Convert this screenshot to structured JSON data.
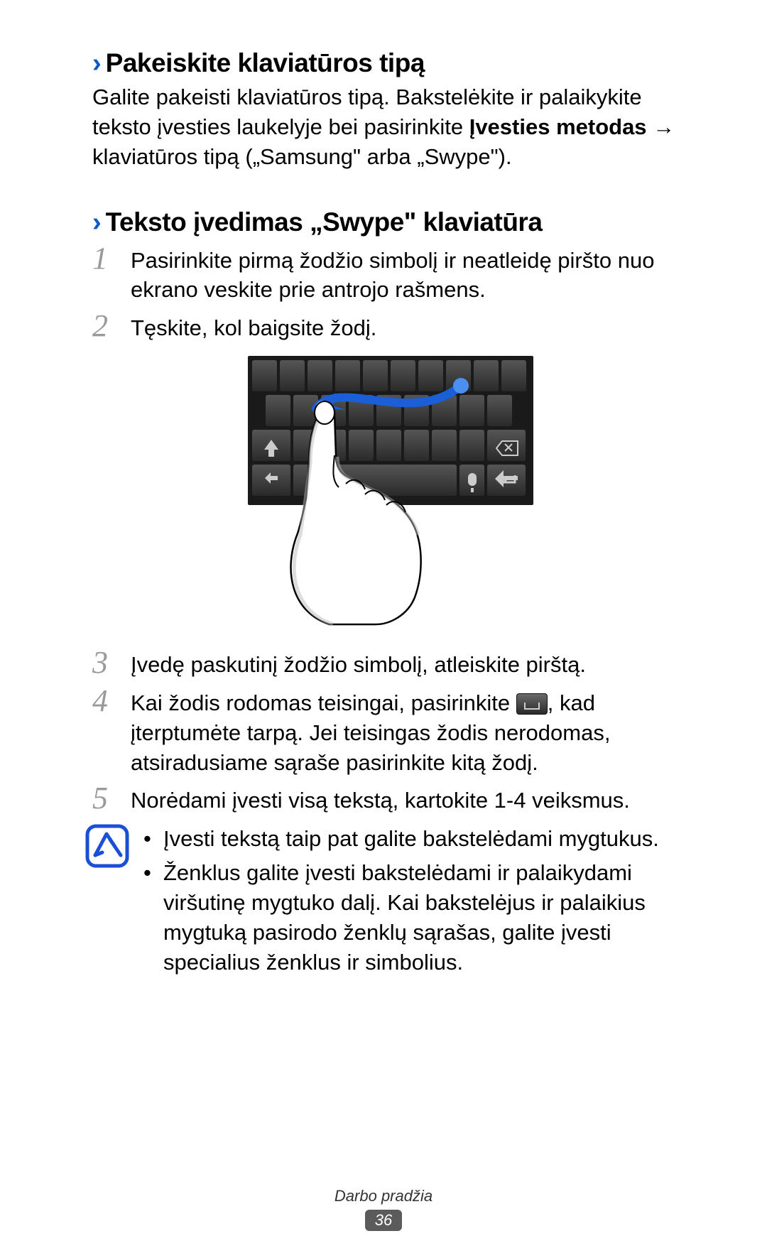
{
  "section1": {
    "heading": "Pakeiskite klaviatūros tipą",
    "body_pre": "Galite pakeisti klaviatūros tipą. Bakstelėkite ir palaikykite teksto įvesties laukelyje bei pasirinkite ",
    "body_bold": "Įvesties metodas",
    "body_post": " → klaviatūros tipą („Samsung\" arba „Swype\")."
  },
  "section2": {
    "heading": "Teksto įvedimas „Swype\" klaviatūra",
    "steps": [
      {
        "num": "1",
        "text": "Pasirinkite pirmą žodžio simbolį ir neatleidę piršto nuo ekrano veskite prie antrojo rašmens."
      },
      {
        "num": "2",
        "text": "Tęskite, kol baigsite žodį."
      },
      {
        "num": "3",
        "text": "Įvedę paskutinį žodžio simbolį, atleiskite pirštą."
      },
      {
        "num": "4",
        "text_pre": "Kai žodis rodomas teisingai, pasirinkite ",
        "text_post": ", kad įterptumėte tarpą. Jei teisingas žodis nerodomas, atsiradusiame sąraše pasirinkite kitą žodį."
      },
      {
        "num": "5",
        "text": "Norėdami įvesti visą tekstą, kartokite 1-4 veiksmus."
      }
    ],
    "notes": [
      "Įvesti tekstą taip pat galite bakstelėdami mygtukus.",
      "Ženklus galite įvesti bakstelėdami ir palaikydami viršutinę mygtuko dalį. Kai bakstelėjus ir palaikius mygtuką pasirodo ženklų sąrašas, galite įvesti specialius ženklus ir simbolius."
    ]
  },
  "footer": {
    "section_title": "Darbo pradžia",
    "page_number": "36"
  }
}
